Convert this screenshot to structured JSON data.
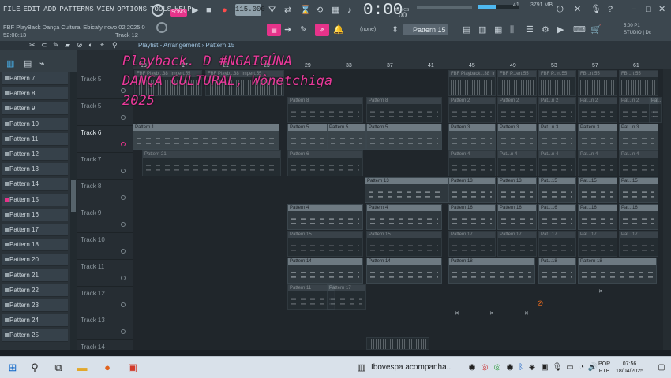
{
  "menu": [
    "FILE",
    "EDIT",
    "ADD",
    "PATTERNS",
    "VIEW",
    "OPTIONS",
    "TOOLS",
    "HELP"
  ],
  "info": {
    "project": "FBF PlayBack Dança Cultural Ebicafy novo.02 2025.0",
    "time": "52:08:13",
    "hint": "Track 12"
  },
  "transport": {
    "mode": "SONG",
    "tempo": "115.000",
    "time_main": "0:00",
    "time_sub": "00",
    "time_label": "M:S:CS",
    "memory": "3791 MB",
    "cpu": "41",
    "pattern_selector": "Pattern 15",
    "none_label": "(none)"
  },
  "top_right_labels": {
    "line1": "5:00 P1",
    "line2": "STUDIO | Dc"
  },
  "breadcrumb": "Playlist - Arrangement › Pattern 15",
  "overlay": {
    "line1": "Playback. D #NGAIGÚNA",
    "line2": "DANÇA CULTURAL, Wônetchiga",
    "line3": "2025"
  },
  "patterns": [
    "Pattern 7",
    "Pattern 8",
    "Pattern 9",
    "Pattern 10",
    "Pattern 11",
    "Pattern 12",
    "Pattern 13",
    "Pattern 14",
    "Pattern 15",
    "Pattern 16",
    "Pattern 17",
    "Pattern 18",
    "Pattern 20",
    "Pattern 21",
    "Pattern 22",
    "Pattern 23",
    "Pattern 24",
    "Pattern 25"
  ],
  "selected_pattern": "Pattern 15",
  "tracks": [
    "Track 5",
    "Track 5",
    "Track 6",
    "Track 7",
    "Track 8",
    "Track 9",
    "Track 10",
    "Track 11",
    "Track 12",
    "Track 13",
    "Track 14"
  ],
  "ruler": [
    "13",
    "17",
    "21",
    "25",
    "29",
    "33",
    "37",
    "41",
    "45",
    "49",
    "53",
    "57",
    "61"
  ],
  "clips": {
    "row0": [
      "FBF Playb...38_Impert.55",
      "FBF Playb...38_Impert.55",
      "FBF Playback...38_Imert.55",
      "FBF P...ert.55",
      "FBF P...rt.55",
      "FB...rt.55",
      "FB...rt.55"
    ],
    "row1": [
      "Pattern 8",
      "Pattern 8",
      "Pattern 2",
      "Pattern 2",
      "Pat...n 2",
      "Pat...n 2",
      "Pat...n 2",
      "Pat...n 2"
    ],
    "row2": [
      "Pattern 1",
      "Pattern 5",
      "Pattern 5",
      "Pattern 5",
      "Pattern 3",
      "Pattern 3",
      "Pat...n 3",
      "Pattern 3",
      "Pat...n 3"
    ],
    "row3": [
      "Pattern 21",
      "Pattern 6",
      "Pattern 4",
      "Pat...n 4",
      "Pat...n 4",
      "Pat...n 4",
      "Pat...n 4"
    ],
    "row4": [
      "Pattern 13",
      "Pattern 13",
      "Pattern 13",
      "Pat...15",
      "Pat...15",
      "Pat...15"
    ],
    "row5": [
      "Pattern 4",
      "Pattern 4",
      "Pattern 16",
      "Pattern 16",
      "Pat...16",
      "Pat...16",
      "Pat...16"
    ],
    "row6": [
      "Pattern 15",
      "Pattern 15",
      "Pattern 17",
      "Pattern 17",
      "Pat...17",
      "Pat...17",
      "Pat...17"
    ],
    "row7": [
      "Pattern 14",
      "Pattern 14",
      "Pattern 18",
      "Pat...18",
      "Pattern 18"
    ],
    "row8": [
      "Pattern 11",
      "Pattern 17"
    ]
  },
  "taskbar": {
    "news": "Ibovespa acompanha...",
    "lang1": "POR",
    "lang2": "PTB",
    "time": "07:56",
    "date": "18/04/2025"
  }
}
